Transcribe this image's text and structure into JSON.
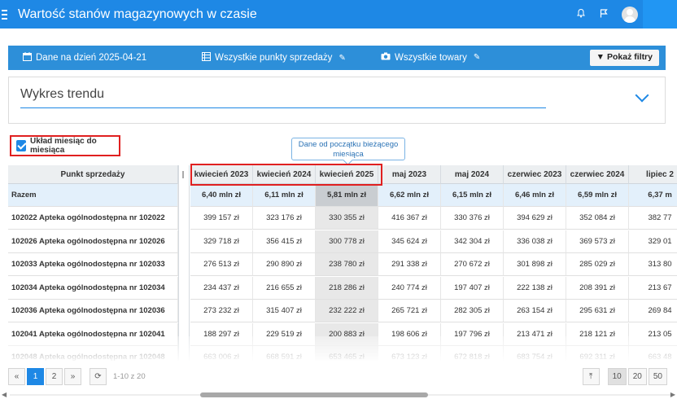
{
  "app": {
    "title": "Wartość stanów magazynowych w czasie"
  },
  "topbar": {
    "icons": [
      "bell-icon",
      "flag-icon",
      "user-avatar"
    ]
  },
  "filters": {
    "date": "Dane na dzień 2025-04-21",
    "points": "Wszystkie punkty sprzedaży",
    "goods": "Wszystkie towary",
    "show_filters": "Pokaż filtry"
  },
  "trend": {
    "label": "Wykres trendu"
  },
  "mom": {
    "label": "Układ miesiąc do miesiąca",
    "checked": true
  },
  "tooltip": {
    "text": "Dane od początku bieżącego miesiąca"
  },
  "table": {
    "name_header": "Punkt sprzedaży",
    "columns": [
      "kwiecień 2023",
      "kwiecień 2024",
      "kwiecień 2025",
      "maj 2023",
      "maj 2024",
      "czerwiec 2023",
      "czerwiec 2024",
      "lipiec 2"
    ],
    "total": {
      "name": "Razem",
      "values": [
        "6,40 mln zł",
        "6,11 mln zł",
        "5,81 mln zł",
        "6,62 mln zł",
        "6,15 mln zł",
        "6,46 mln zł",
        "6,59 mln zł",
        "6,37 m"
      ]
    },
    "rows": [
      {
        "name": "102022 Apteka ogólnodostępna nr 102022",
        "values": [
          "399 157 zł",
          "323 176 zł",
          "330 355 zł",
          "416 367 zł",
          "330 376 zł",
          "394 629 zł",
          "352 084 zł",
          "382 77"
        ]
      },
      {
        "name": "102026 Apteka ogólnodostępna nr 102026",
        "values": [
          "329 718 zł",
          "356 415 zł",
          "300 778 zł",
          "345 624 zł",
          "342 304 zł",
          "336 038 zł",
          "369 573 zł",
          "329 01"
        ]
      },
      {
        "name": "102033 Apteka ogólnodostępna nr 102033",
        "values": [
          "276 513 zł",
          "290 890 zł",
          "238 780 zł",
          "291 338 zł",
          "270 672 zł",
          "301 898 zł",
          "285 029 zł",
          "313 80"
        ]
      },
      {
        "name": "102034 Apteka ogólnodostępna nr 102034",
        "values": [
          "234 437 zł",
          "216 655 zł",
          "218 286 zł",
          "240 774 zł",
          "197 407 zł",
          "222 138 zł",
          "208 391 zł",
          "213 67"
        ]
      },
      {
        "name": "102036 Apteka ogólnodostępna nr 102036",
        "values": [
          "273 232 zł",
          "315 407 zł",
          "232 222 zł",
          "265 721 zł",
          "282 305 zł",
          "263 154 zł",
          "295 631 zł",
          "269 84"
        ]
      },
      {
        "name": "102041 Apteka ogólnodostępna nr 102041",
        "values": [
          "188 297 zł",
          "229 519 zł",
          "200 883 zł",
          "198 606 zł",
          "197 796 zł",
          "213 471 zł",
          "218 121 zł",
          "213 05"
        ]
      },
      {
        "name": "102048 Apteka ogólnodostępna nr 102048",
        "values": [
          "663 006 zł",
          "668 591 zł",
          "653 465 zł",
          "673 123 zł",
          "672 818 zł",
          "683 754 zł",
          "692 311 zł",
          "663 48"
        ]
      }
    ]
  },
  "pagination": {
    "prev": "«",
    "pages": [
      "1",
      "2"
    ],
    "next": "»",
    "info": "1-10 z 20",
    "sizes": [
      "10",
      "20",
      "50"
    ]
  }
}
